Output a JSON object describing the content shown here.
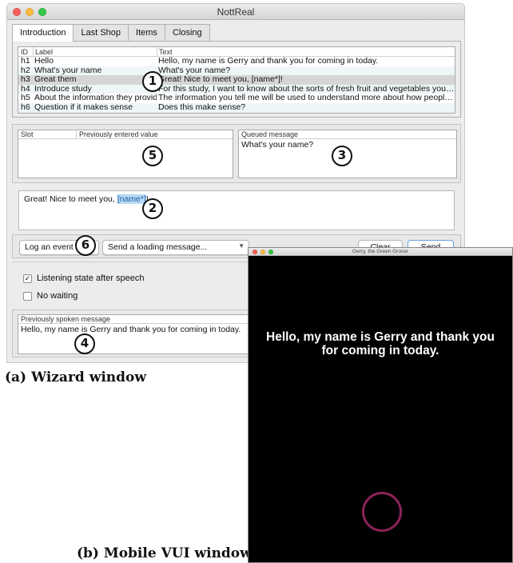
{
  "wizard": {
    "window_title": "NottReal",
    "tabs": [
      {
        "label": "Introduction",
        "active": true
      },
      {
        "label": "Last Shop"
      },
      {
        "label": "Items"
      },
      {
        "label": "Closing"
      }
    ],
    "messages_table": {
      "columns": [
        "ID",
        "Label",
        "Text"
      ],
      "rows": [
        {
          "id": "h1",
          "label": "Hello",
          "text": "Hello, my name is Gerry and thank you for coming in today."
        },
        {
          "id": "h2",
          "label": "What's your name",
          "text": "What's your name?"
        },
        {
          "id": "h3",
          "label": "Great them",
          "text": "Great! Nice to meet you, [name*]!",
          "selected": true
        },
        {
          "id": "h4",
          "label": "Introduce study",
          "text": "For this study, I want to know about the sorts of fresh fruit and vegetables you buy,..."
        },
        {
          "id": "h5",
          "label": "About the information they provide",
          "text": "The information you tell me will be used to understand more about how people pick..."
        },
        {
          "id": "h6",
          "label": "Question if it makes sense",
          "text": "Does this make sense?"
        }
      ]
    },
    "slots": {
      "columns": [
        "Slot",
        "Previously entered value"
      ]
    },
    "queue": {
      "header": "Queued message",
      "value": "What's your name?"
    },
    "editor": {
      "prefix": "Great! Nice to meet you, ",
      "slot": "[name*]",
      "suffix": "!"
    },
    "controls": {
      "log_event": "Log an event",
      "loading_message": "Send a loading message...",
      "clear": "Clear",
      "send": "Send"
    },
    "checks": {
      "listening": {
        "label": "Listening state after speech",
        "checked": true
      },
      "no_waiting": {
        "label": "No waiting",
        "checked": false
      }
    },
    "spoken": {
      "header": "Previously spoken message",
      "value": "Hello, my name is Gerry and thank you for coming in today."
    }
  },
  "markers": [
    "1",
    "2",
    "3",
    "4",
    "5",
    "6"
  ],
  "captions": {
    "wizard": "(a) Wizard window",
    "vui": "(b) Mobile VUI window"
  },
  "vui": {
    "window_title": "Gerry, the Green Grocer",
    "message": "Hello, my name is Gerry and thank you for coming in today.",
    "ring_color": "#8c2358"
  }
}
